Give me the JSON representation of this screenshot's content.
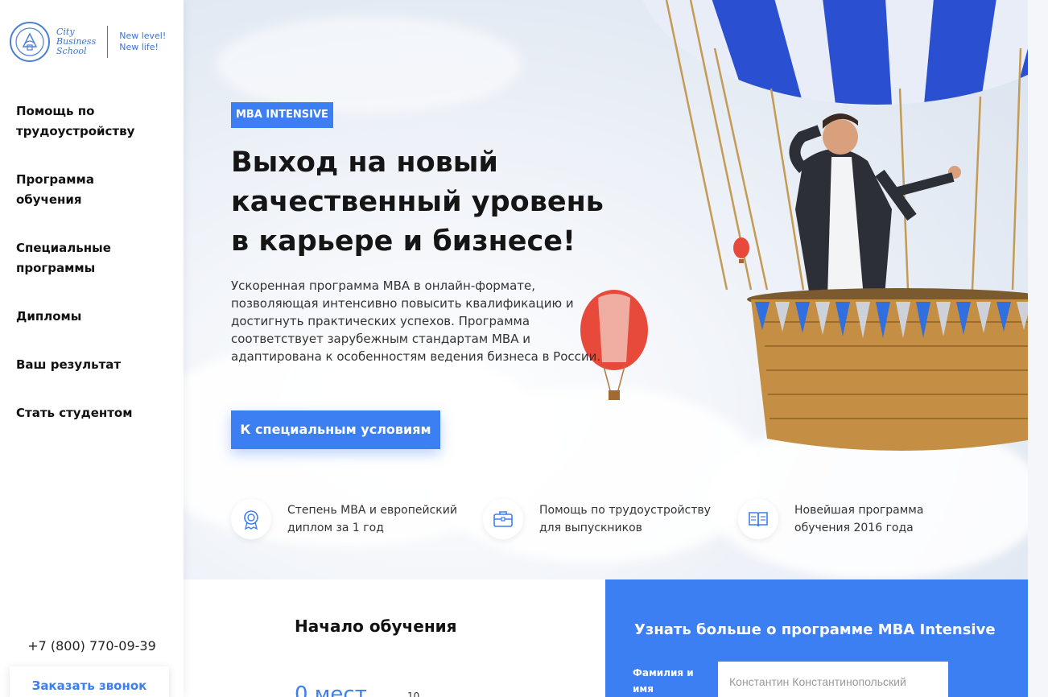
{
  "sidebar": {
    "logo": {
      "line1": "City",
      "line2": "Business",
      "line3": "School",
      "slogan1": "New level!",
      "slogan2": "New life!"
    },
    "nav": [
      {
        "label": "Помощь по трудоустройству"
      },
      {
        "label": "Программа обучения"
      },
      {
        "label": "Специальные программы"
      },
      {
        "label": "Дипломы"
      },
      {
        "label": "Ваш результат"
      },
      {
        "label": "Стать студентом"
      }
    ],
    "phone": "+7 (800) 770-09-39",
    "callback_label": "Заказать звонок"
  },
  "hero": {
    "badge": "MBA INTENSIVE",
    "headline": "Выход на новый качественный уровень в карьере и бизнесе!",
    "description": "Ускоренная программа MBA в онлайн-формате, позволяющая интенсивно повысить квалификацию и достигнуть практических успехов. Программа соответствует зарубежным стандартам MBA и адаптирована к особенностям ведения бизнеса в России.",
    "cta_label": "К специальным условиям",
    "features": [
      {
        "icon": "award-medal-icon",
        "text": "Степень MBA и европейский диплом за 1 год"
      },
      {
        "icon": "briefcase-icon",
        "text": "Помощь по трудоустройству для выпускников"
      },
      {
        "icon": "open-book-icon",
        "text": "Новейшая программа обучения 2016 года"
      }
    ]
  },
  "start": {
    "title": "Начало обучения",
    "seats": "0 мест",
    "seats_note": "10"
  },
  "form": {
    "title": "Узнать больше о программе MBA Intensive",
    "name_label": "Фамилия и имя",
    "name_placeholder": "Константин Константинопольский"
  },
  "colors": {
    "accent": "#3b7ff2",
    "text": "#111111",
    "balloon_blue": "#2a4fd0"
  }
}
